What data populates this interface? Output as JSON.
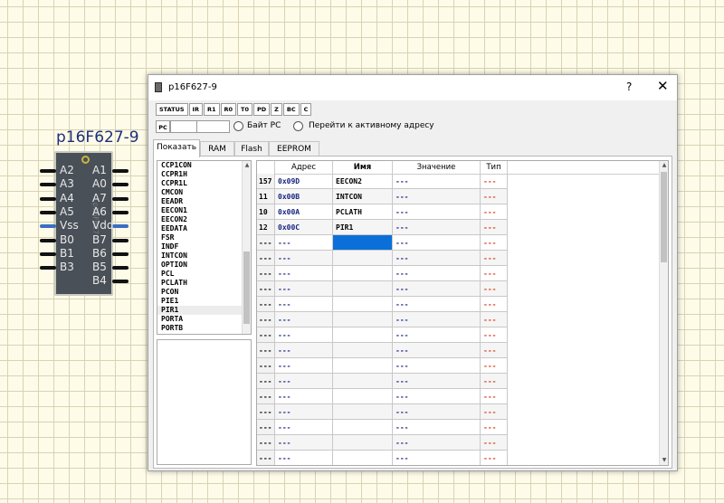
{
  "chip": {
    "name": "p16F627-9",
    "body_text": "p16F627",
    "pins_left": [
      "A2",
      "A3",
      "A4",
      "A5",
      "Vss",
      "B0",
      "B1",
      "B3"
    ],
    "pins_right": [
      "A1",
      "A0",
      "A7",
      "A6",
      "Vdd",
      "B7",
      "B6",
      "B5",
      "B4"
    ]
  },
  "window": {
    "title": "p16F627-9",
    "help_label": "?",
    "close_label": "✕"
  },
  "flags": [
    "STATUS",
    "IR",
    "R1",
    "R0",
    "T0",
    "PD",
    "Z",
    "BC",
    "C"
  ],
  "pc": {
    "label": "PC",
    "radio_byte_label": "Байт PC",
    "radio_goto_label": "Перейти к активному адресу"
  },
  "tabs": [
    {
      "label": "Показать",
      "active": true
    },
    {
      "label": "RAM",
      "active": false
    },
    {
      "label": "Flash",
      "active": false
    },
    {
      "label": "EEPROM",
      "active": false
    }
  ],
  "register_list": [
    "CCP1CON",
    "CCPR1H",
    "CCPR1L",
    "CMCON",
    "EEADR",
    "EECON1",
    "EECON2",
    "EEDATA",
    "FSR",
    "INDF",
    "INTCON",
    "OPTION",
    "PCL",
    "PCLATH",
    "PCON",
    "PIE1",
    "PIR1",
    "PORTA",
    "PORTB"
  ],
  "register_list_selected": "PIR1",
  "table": {
    "headers": {
      "address": "Адрес",
      "name": "Имя",
      "value": "Значение",
      "type": "Тип"
    },
    "rows": [
      {
        "idx": "157",
        "addr": "0x09D",
        "name": "EECON2",
        "value": " ---",
        "type": "---"
      },
      {
        "idx": "11",
        "addr": "0x00B",
        "name": "INTCON",
        "value": "---",
        "type": "---"
      },
      {
        "idx": "10",
        "addr": "0x00A",
        "name": "PCLATH",
        "value": "---",
        "type": "---"
      },
      {
        "idx": "12",
        "addr": "0x00C",
        "name": "PIR1",
        "value": "---",
        "type": "---"
      },
      {
        "idx": "---",
        "addr": "---",
        "name": "",
        "value": "---",
        "type": "---"
      },
      {
        "idx": "---",
        "addr": "---",
        "name": "",
        "value": "---",
        "type": "---"
      },
      {
        "idx": "---",
        "addr": "---",
        "name": "",
        "value": "---",
        "type": "---"
      },
      {
        "idx": "---",
        "addr": "---",
        "name": "",
        "value": "---",
        "type": "---"
      },
      {
        "idx": "---",
        "addr": "---",
        "name": "",
        "value": "---",
        "type": "---"
      },
      {
        "idx": "---",
        "addr": "---",
        "name": "",
        "value": "---",
        "type": "---"
      },
      {
        "idx": "---",
        "addr": "---",
        "name": "",
        "value": "---",
        "type": "---"
      },
      {
        "idx": "---",
        "addr": "---",
        "name": "",
        "value": "---",
        "type": "---"
      },
      {
        "idx": "---",
        "addr": "---",
        "name": "",
        "value": "---",
        "type": "---"
      },
      {
        "idx": "---",
        "addr": "---",
        "name": "",
        "value": "---",
        "type": "---"
      },
      {
        "idx": "---",
        "addr": "---",
        "name": "",
        "value": "---",
        "type": "---"
      },
      {
        "idx": "---",
        "addr": "---",
        "name": "",
        "value": "---",
        "type": "---"
      },
      {
        "idx": "---",
        "addr": "---",
        "name": "",
        "value": "---",
        "type": "---"
      },
      {
        "idx": "---",
        "addr": "---",
        "name": "",
        "value": "---",
        "type": "---"
      },
      {
        "idx": "---",
        "addr": "---",
        "name": "",
        "value": "---",
        "type": "---"
      },
      {
        "idx": "---",
        "addr": "---",
        "name": "",
        "value": "---",
        "type": "---"
      }
    ]
  },
  "colors": {
    "address_text": "#17247f",
    "type_text": "#d43a1a",
    "selection": "#0a6fd9"
  }
}
